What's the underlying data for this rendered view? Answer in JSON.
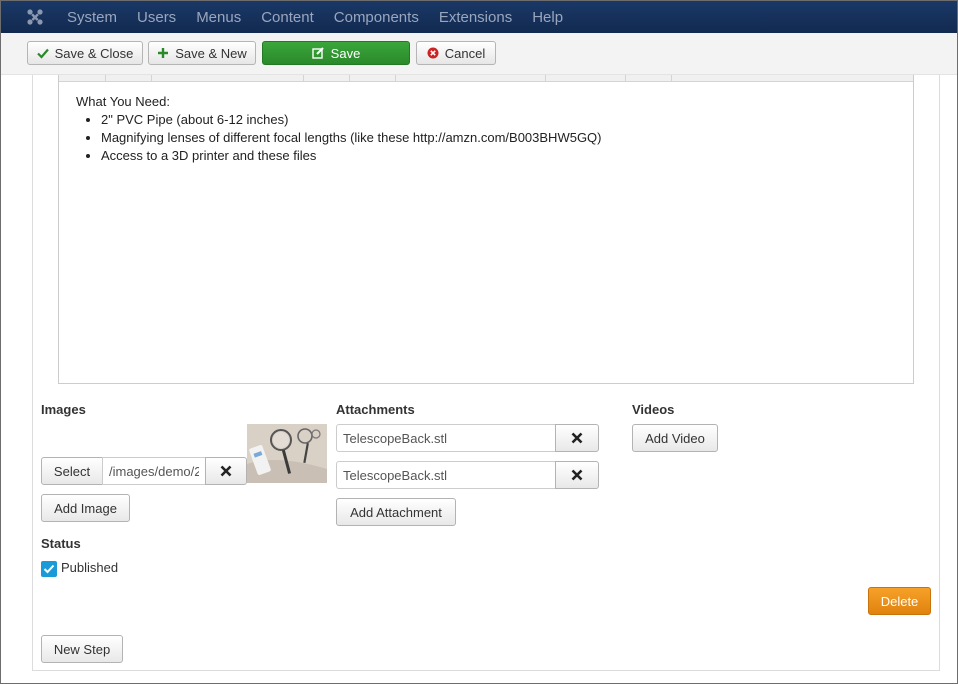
{
  "nav": {
    "items": [
      "System",
      "Users",
      "Menus",
      "Content",
      "Components",
      "Extensions",
      "Help"
    ]
  },
  "toolbar": {
    "save_close": "Save & Close",
    "save_new": "Save & New",
    "save": "Save",
    "cancel": "Cancel"
  },
  "editor": {
    "heading": "What You Need:",
    "items": [
      "2\" PVC Pipe (about 6-12 inches)",
      "Magnifying lenses of different focal lengths (like these http://amzn.com/B003BHW5GQ)",
      "Access to a 3D printer and these files"
    ]
  },
  "images": {
    "title": "Images",
    "select_label": "Select",
    "path_value": "/images/demo/2",
    "add_label": "Add Image"
  },
  "attachments": {
    "title": "Attachments",
    "files": [
      "TelescopeBack.stl",
      "TelescopeBack.stl"
    ],
    "add_label": "Add Attachment"
  },
  "videos": {
    "title": "Videos",
    "add_label": "Add Video"
  },
  "status": {
    "title": "Status",
    "published_label": "Published",
    "published": true
  },
  "actions": {
    "delete_label": "Delete",
    "new_step_label": "New Step"
  },
  "colors": {
    "nav_bg": "#172b4d",
    "save_green": "#2f962f",
    "delete_orange": "#f0921c",
    "checkbox_blue": "#1a9bd7"
  }
}
